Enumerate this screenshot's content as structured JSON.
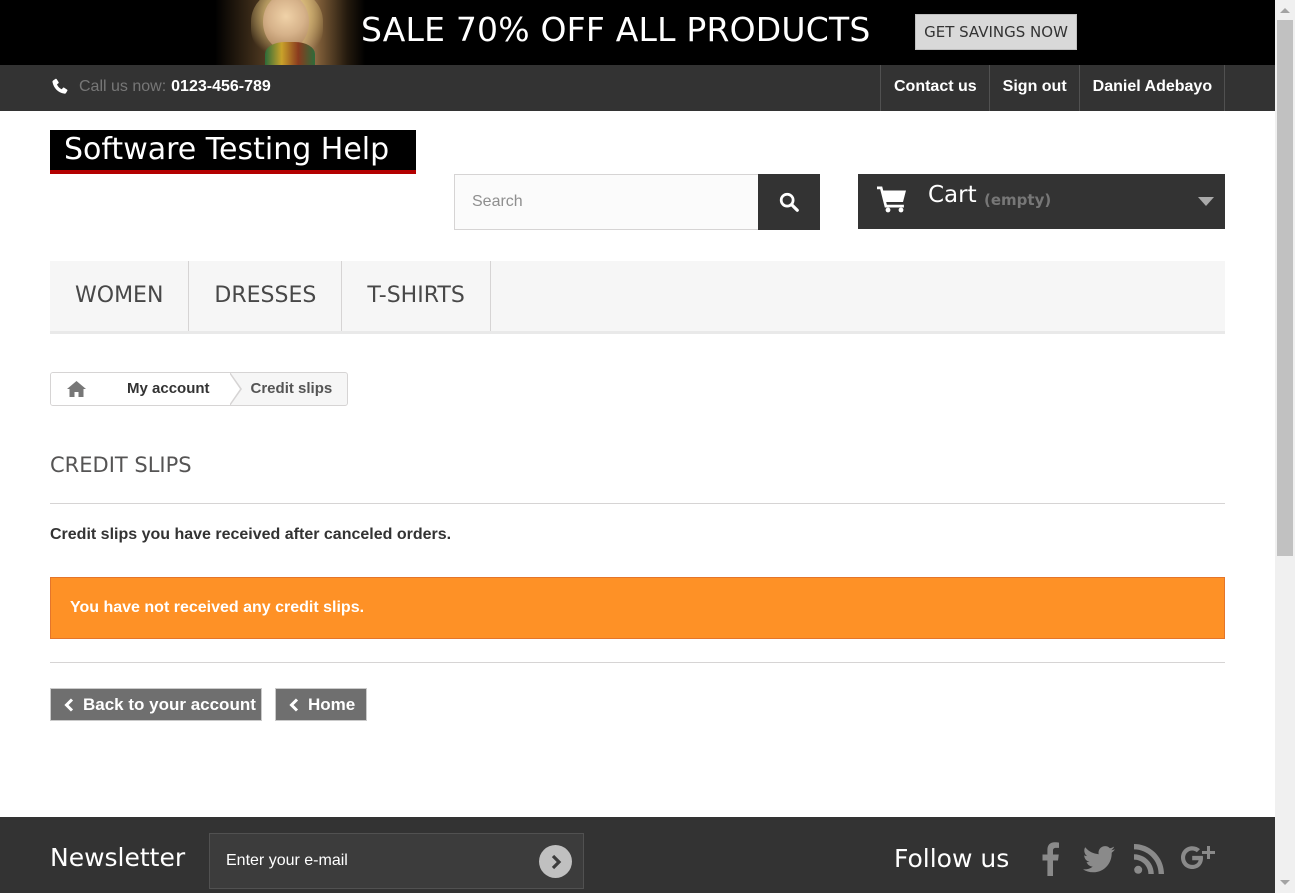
{
  "banner": {
    "title": "SALE 70% OFF ALL PRODUCTS",
    "cta_label": "GET SAVINGS NOW"
  },
  "topbar": {
    "phone_label": "Call us now:",
    "phone_number": "0123-456-789",
    "links": [
      "Contact us",
      "Sign out",
      "Daniel Adebayo"
    ]
  },
  "header": {
    "logo_text": "Software Testing Help",
    "search_placeholder": "Search",
    "cart_label": "Cart",
    "cart_status": "(empty)"
  },
  "menu": {
    "items": [
      "WOMEN",
      "DRESSES",
      "T-SHIRTS"
    ]
  },
  "breadcrumb": {
    "home_icon": "home-icon",
    "items": [
      "My account",
      "Credit slips"
    ]
  },
  "content": {
    "heading": "CREDIT SLIPS",
    "intro": "Credit slips you have received after canceled orders.",
    "alert": "You have not received any credit slips.",
    "back_button": "Back to your account",
    "home_button": "Home"
  },
  "footer": {
    "newsletter_title": "Newsletter",
    "newsletter_placeholder": "Enter your e-mail",
    "follow_title": "Follow us",
    "social_icons": [
      "facebook-icon",
      "twitter-icon",
      "rss-icon",
      "google-plus-icon"
    ]
  },
  "colors": {
    "dark_bar": "#333333",
    "alert_orange": "#fe9126",
    "logo_underline": "#b30000",
    "button_gray": "#6f6f6f",
    "menu_bg": "#f6f6f6"
  }
}
